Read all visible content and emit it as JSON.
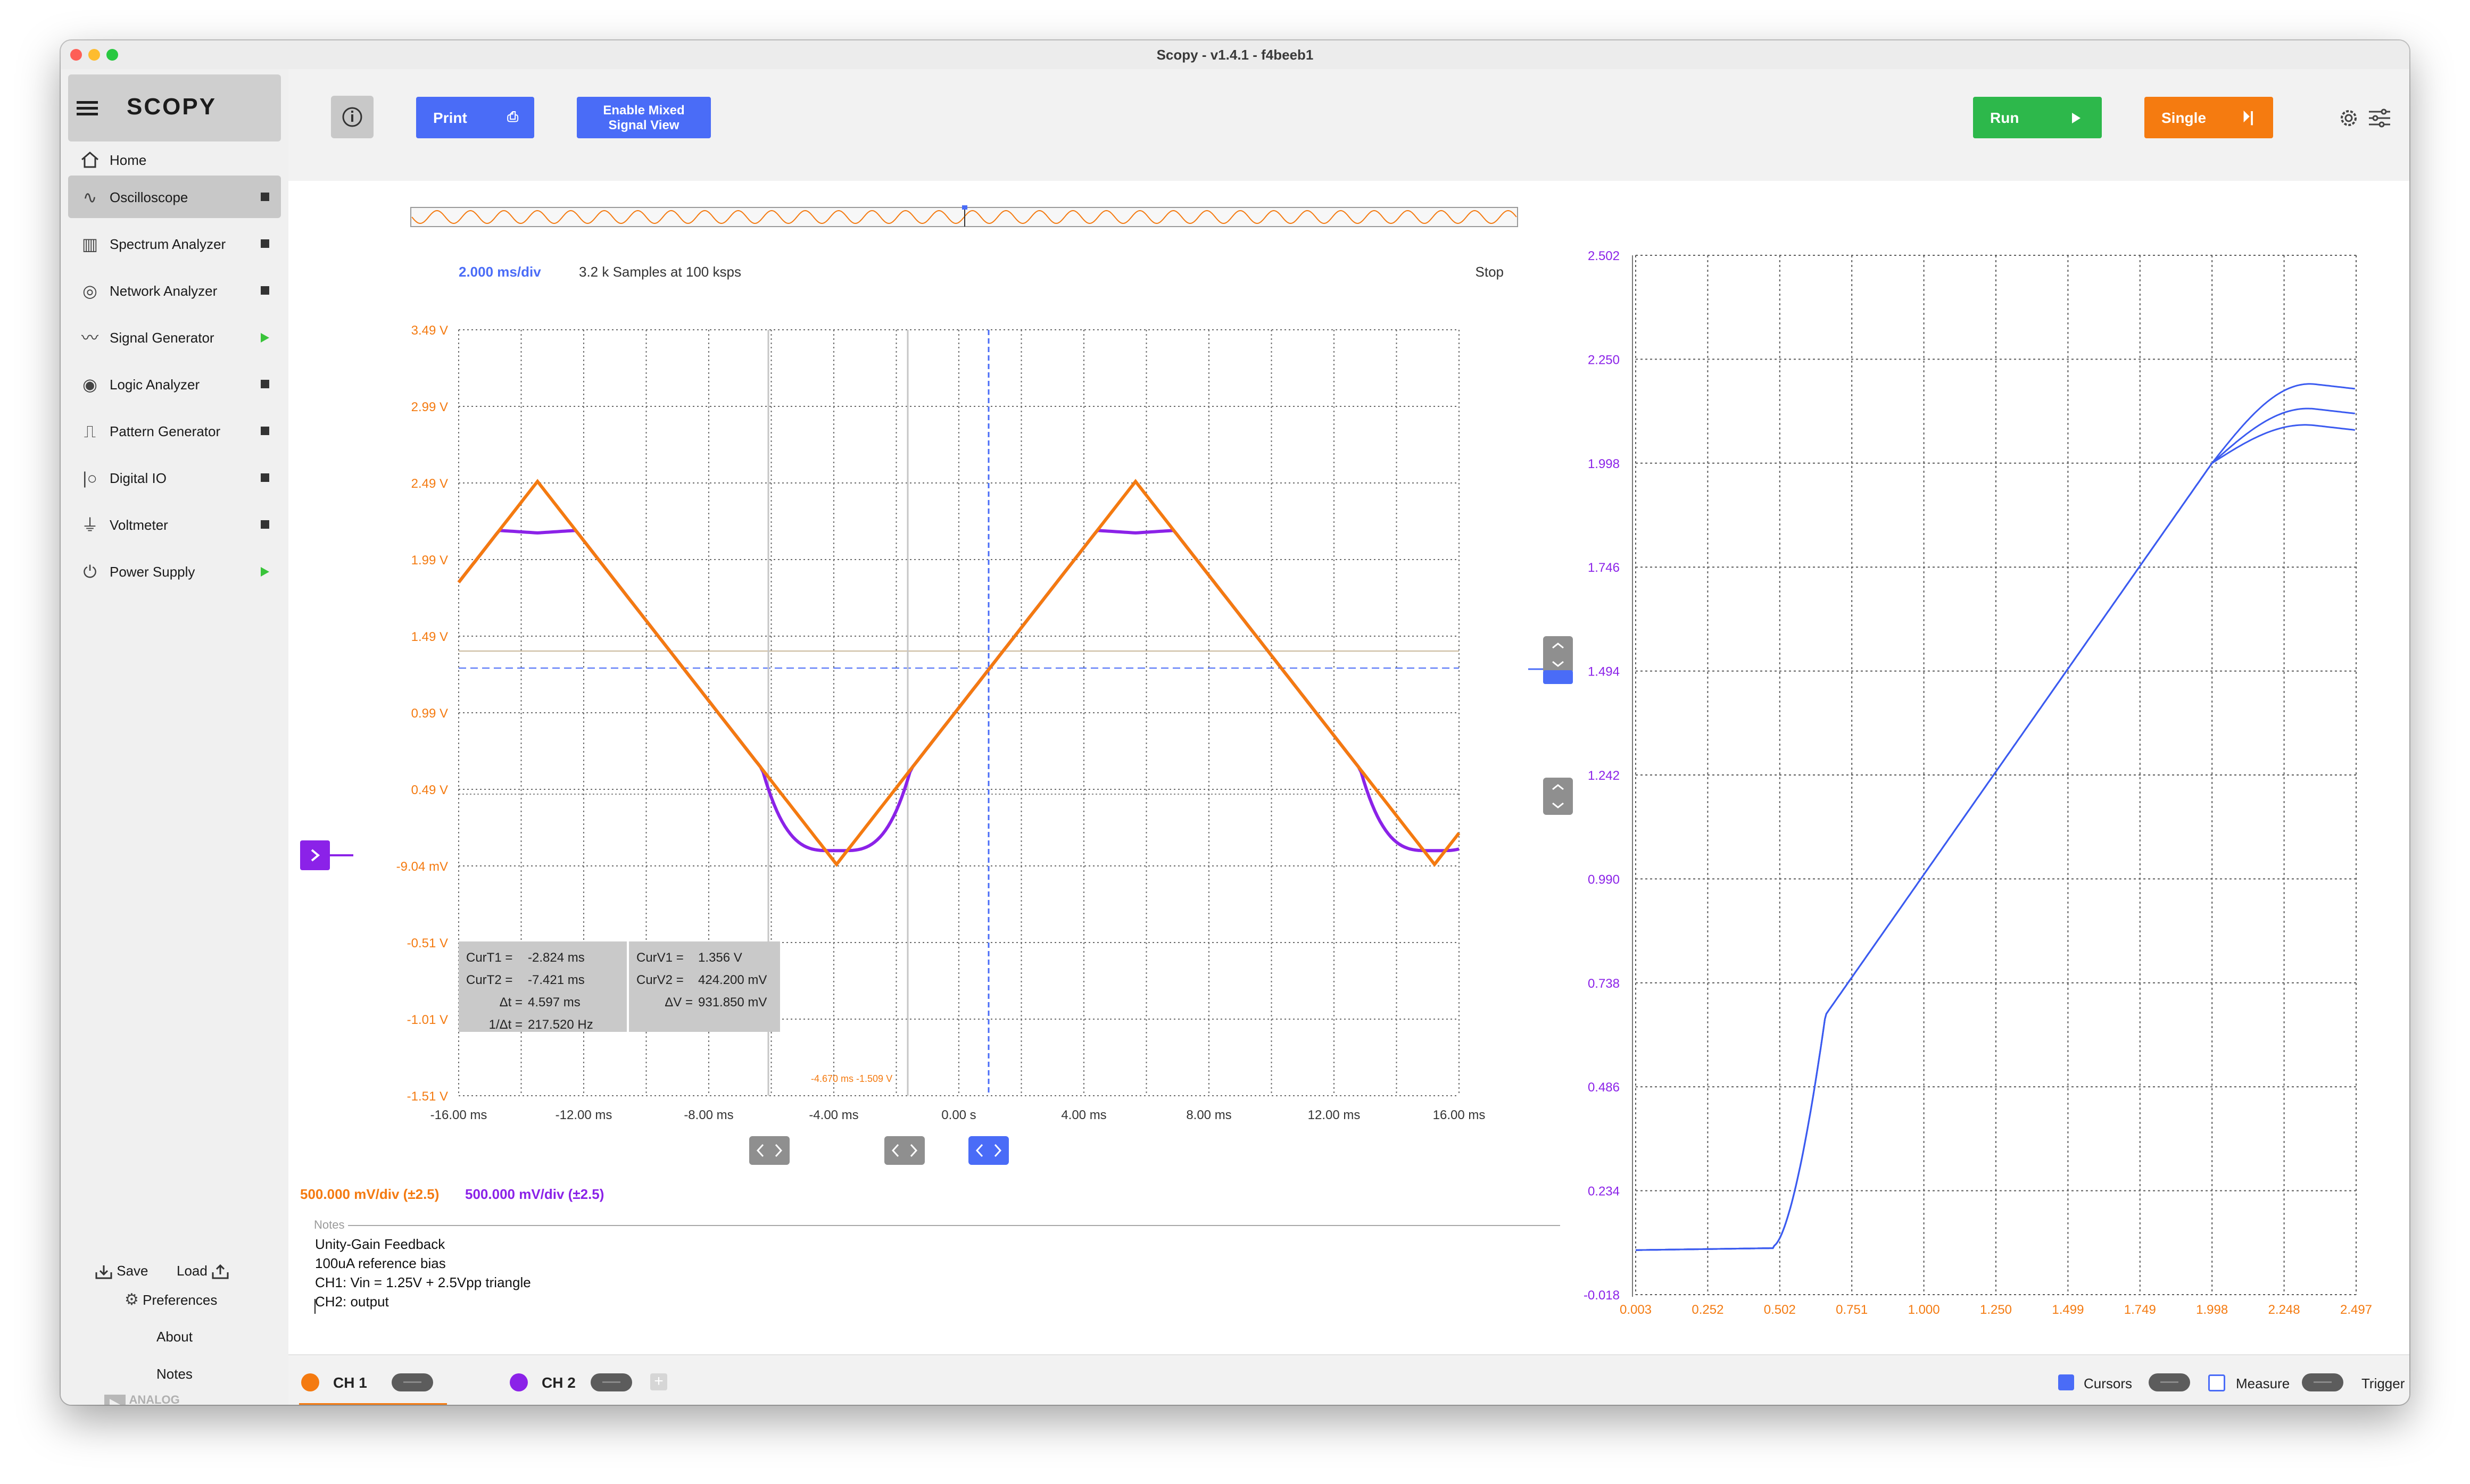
{
  "window": {
    "title": "Scopy - v1.4.1 - f4beeb1"
  },
  "sidebar": {
    "logo": "SCOPY",
    "home_label": "Home",
    "items": [
      {
        "label": "Oscilloscope",
        "icon": "oscilloscope-icon",
        "state": "stop",
        "active": true
      },
      {
        "label": "Spectrum Analyzer",
        "icon": "spectrum-icon",
        "state": "stop"
      },
      {
        "label": "Network Analyzer",
        "icon": "network-icon",
        "state": "stop"
      },
      {
        "label": "Signal Generator",
        "icon": "signal-icon",
        "state": "run"
      },
      {
        "label": "Logic Analyzer",
        "icon": "logic-icon",
        "state": "stop"
      },
      {
        "label": "Pattern Generator",
        "icon": "pattern-icon",
        "state": "stop"
      },
      {
        "label": "Digital IO",
        "icon": "digitalio-icon",
        "state": "stop"
      },
      {
        "label": "Voltmeter",
        "icon": "voltmeter-icon",
        "state": "stop"
      },
      {
        "label": "Power Supply",
        "icon": "power-icon",
        "state": "run"
      }
    ],
    "save_label": "Save",
    "load_label": "Load",
    "preferences_label": "Preferences",
    "about_label": "About",
    "notes_label": "Notes",
    "brand": "ANALOG DEVICES"
  },
  "toolbar": {
    "print_label": "Print",
    "mixed_label_1": "Enable Mixed",
    "mixed_label_2": "Signal View",
    "run_label": "Run",
    "single_label": "Single"
  },
  "colors": {
    "ch1": "#f47a10",
    "ch2": "#8b22e8",
    "accent_blue": "#4a6cf7",
    "run_green": "#2db84b",
    "single_orange": "#f57b10"
  },
  "scope": {
    "timebase": "2.000 ms/div",
    "samples": "3.2 k Samples at 100 ksps",
    "status": "Stop",
    "y_labels": [
      "3.49 V",
      "2.99 V",
      "2.49 V",
      "1.99 V",
      "1.49 V",
      "0.99 V",
      "0.49 V",
      "-9.04 mV",
      "-0.51 V",
      "-1.01 V",
      "-1.51 V"
    ],
    "x_labels": [
      "-16.00 ms",
      "-12.00 ms",
      "-8.00 ms",
      "-4.00 ms",
      "0.00 s",
      "4.00 ms",
      "8.00 ms",
      "12.00 ms",
      "16.00 ms"
    ],
    "cursor_marker": "-4.670 ms -1.509 V",
    "cursor_readout": {
      "curT1_label": "CurT1 =",
      "curT1": "-2.824 ms",
      "curT2_label": "CurT2 =",
      "curT2": "-7.421 ms",
      "dt_label": "Δt =",
      "dt": "4.597 ms",
      "inv_dt_label": "1/Δt =",
      "inv_dt": "217.520 Hz",
      "curV1_label": "CurV1 =",
      "curV1": "1.356 V",
      "curV2_label": "CurV2 =",
      "curV2": "424.200 mV",
      "dv_label": "ΔV =",
      "dv": "931.850 mV"
    },
    "ch1_scale": "500.000 mV/div (±2.5)",
    "ch2_scale": "500.000 mV/div (±2.5)"
  },
  "xy_plot": {
    "y_labels": [
      "2.502",
      "2.250",
      "1.998",
      "1.746",
      "1.494",
      "1.242",
      "0.990",
      "0.738",
      "0.486",
      "0.234",
      "-0.018"
    ],
    "x_labels": [
      "0.003",
      "0.252",
      "0.502",
      "0.751",
      "1.000",
      "1.250",
      "1.499",
      "1.749",
      "1.998",
      "2.248",
      "2.497"
    ]
  },
  "notes": {
    "header": "Notes",
    "lines": [
      "Unity-Gain Feedback",
      "100uA reference bias",
      "CH1: Vin = 1.25V + 2.5Vpp triangle",
      "CH2: output"
    ]
  },
  "bottom": {
    "ch1_label": "CH 1",
    "ch2_label": "CH 2",
    "add_label": "+",
    "cursors_label": "Cursors",
    "measure_label": "Measure",
    "trigger_label": "Trigger"
  }
}
